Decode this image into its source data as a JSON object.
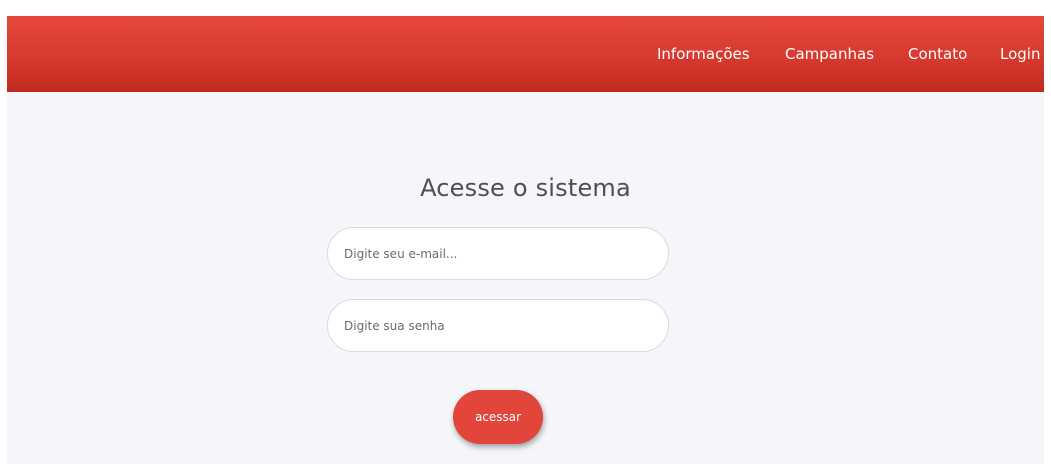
{
  "colors": {
    "navbar": "#d63a2f",
    "page_background": "#f4f6fa",
    "button": "#e2463a"
  },
  "navbar": {
    "links": [
      {
        "label": "Informações"
      },
      {
        "label": "Campanhas"
      },
      {
        "label": "Contato"
      },
      {
        "label": "Login"
      }
    ]
  },
  "login": {
    "title": "Acesse o sistema",
    "email_placeholder": "Digite seu e-mail...",
    "password_placeholder": "Digite sua senha",
    "submit_label": "acessar"
  }
}
